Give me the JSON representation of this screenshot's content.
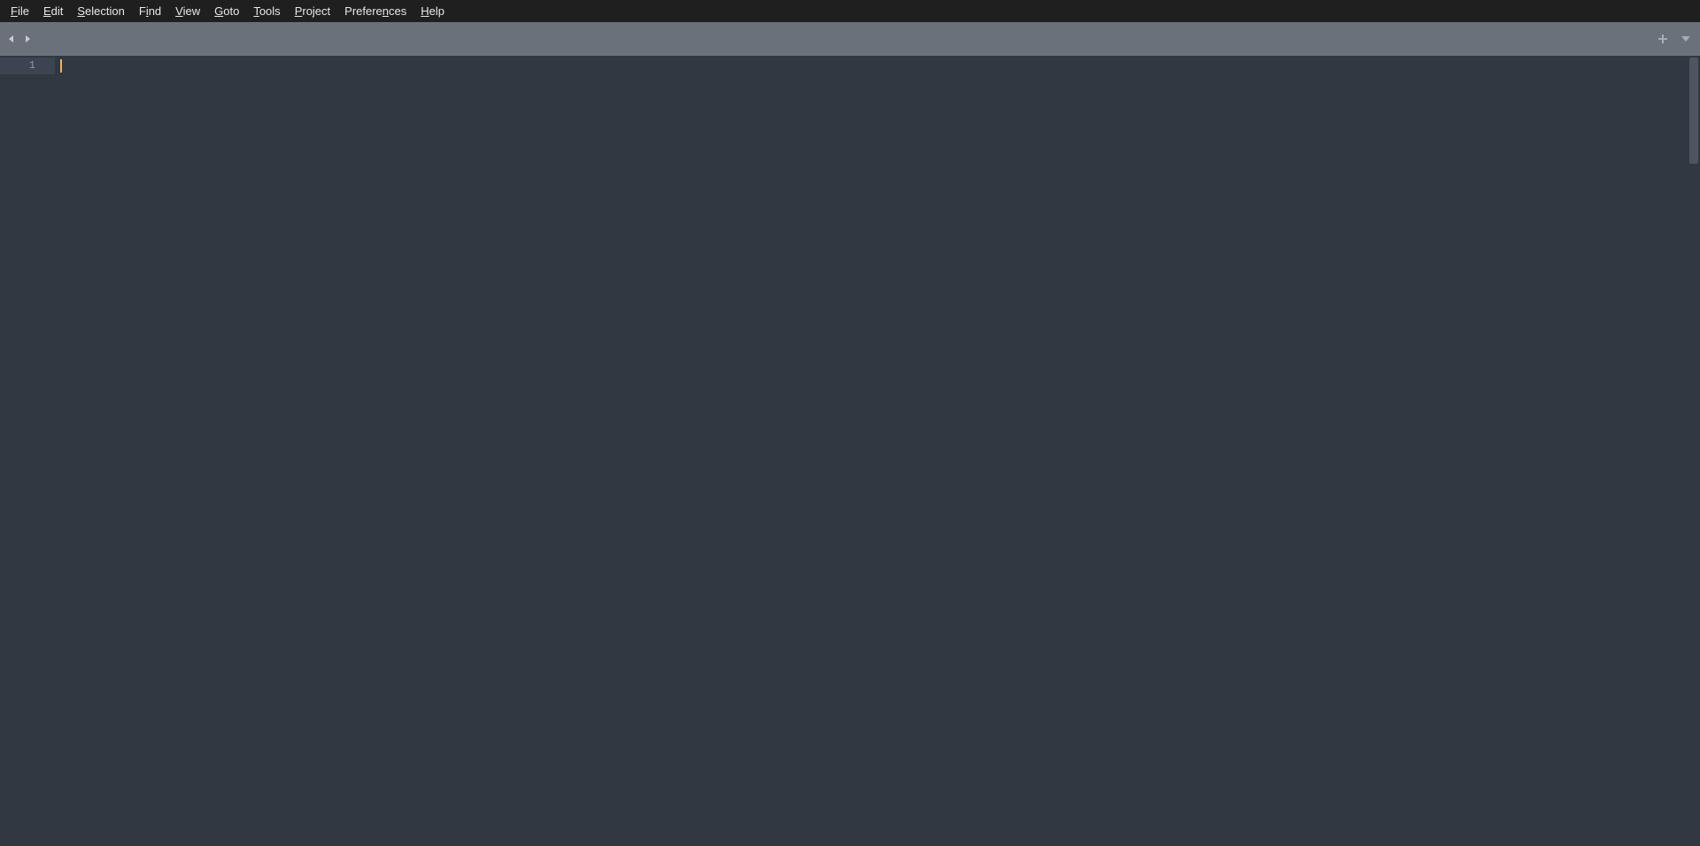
{
  "menubar": {
    "items": [
      {
        "id": "file",
        "pre": "",
        "mne": "F",
        "post": "ile"
      },
      {
        "id": "edit",
        "pre": "",
        "mne": "E",
        "post": "dit"
      },
      {
        "id": "selection",
        "pre": "",
        "mne": "S",
        "post": "election"
      },
      {
        "id": "find",
        "pre": "F",
        "mne": "i",
        "post": "nd"
      },
      {
        "id": "view",
        "pre": "",
        "mne": "V",
        "post": "iew"
      },
      {
        "id": "goto",
        "pre": "",
        "mne": "G",
        "post": "oto"
      },
      {
        "id": "tools",
        "pre": "",
        "mne": "T",
        "post": "ools"
      },
      {
        "id": "project",
        "pre": "",
        "mne": "P",
        "post": "roject"
      },
      {
        "id": "preferences",
        "pre": "Prefere",
        "mne": "n",
        "post": "ces"
      },
      {
        "id": "help",
        "pre": "",
        "mne": "H",
        "post": "elp"
      }
    ]
  },
  "gutter": {
    "line1": "1"
  }
}
